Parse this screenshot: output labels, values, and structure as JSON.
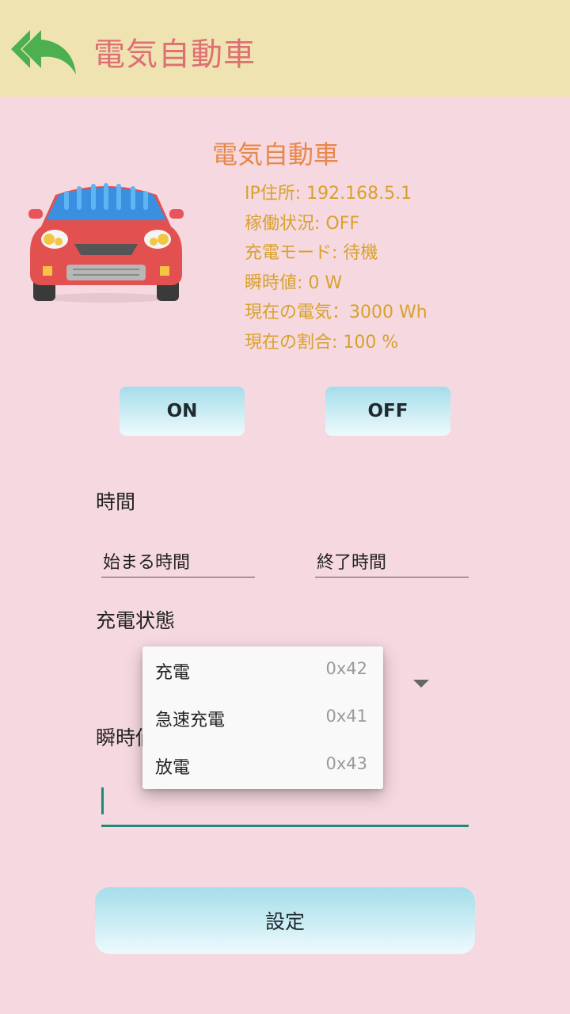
{
  "appbar": {
    "title": "電気自動車",
    "back_icon": "double-back-arrow-icon",
    "accent": "#4caf50"
  },
  "device": {
    "title": "電気自動車",
    "icon": "car-icon",
    "info": [
      "IP住所: 192.168.5.1",
      "稼働状況: OFF",
      "充電モード: 待機",
      "瞬時値: 0 W",
      "現在の電気：3000 Wh",
      "現在の割合: 100 %"
    ]
  },
  "buttons": {
    "on": "ON",
    "off": "OFF",
    "set": "設定"
  },
  "time_section": {
    "label": "時間",
    "start_placeholder": "始まる時間",
    "end_placeholder": "終了時間"
  },
  "charge_section": {
    "label": "充電状態"
  },
  "instant_section": {
    "label": "瞬時値"
  },
  "dropdown": {
    "options": [
      {
        "label": "充電",
        "code": "0x42"
      },
      {
        "label": "急速充電",
        "code": "0x41"
      },
      {
        "label": "放電",
        "code": "0x43"
      }
    ]
  }
}
